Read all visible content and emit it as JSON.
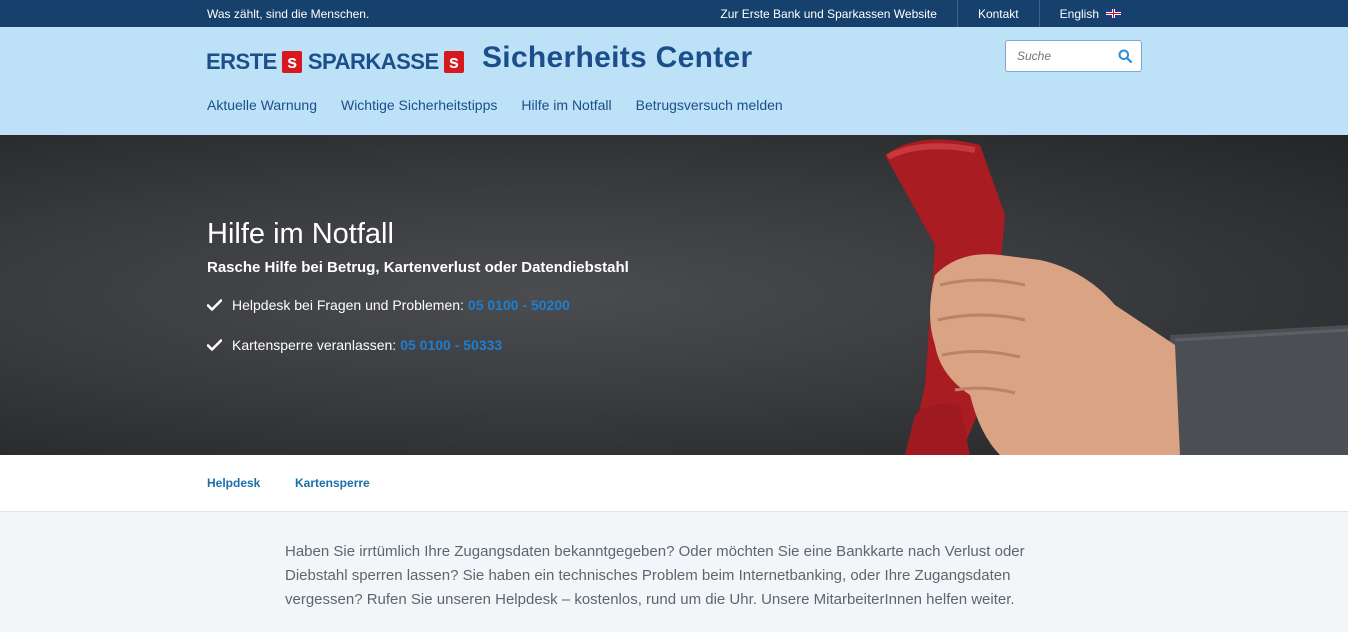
{
  "topbar": {
    "tagline": "Was zählt, sind die Menschen.",
    "links": [
      {
        "label": "Zur Erste Bank und Sparkassen Website"
      },
      {
        "label": "Kontakt"
      },
      {
        "label": "English"
      }
    ]
  },
  "header": {
    "logo_part1": "ERSTE",
    "logo_part2": "SPARKASSE",
    "logo_mark": "s",
    "title": "Sicherheits Center",
    "search_placeholder": "Suche",
    "nav": [
      {
        "label": "Aktuelle Warnung"
      },
      {
        "label": "Wichtige Sicherheitstipps"
      },
      {
        "label": "Hilfe im Notfall"
      },
      {
        "label": "Betrugsversuch melden"
      }
    ]
  },
  "hero": {
    "title": "Hilfe im Notfall",
    "subtitle": "Rasche Hilfe bei Betrug, Kartenverlust oder Datendiebstahl",
    "items": [
      {
        "text": "Helpdesk bei Fragen und Problemen:",
        "phone": "05 0100 - 50200"
      },
      {
        "text": "Kartensperre veranlassen:",
        "phone": "05 0100 - 50333"
      }
    ]
  },
  "subtabs": [
    {
      "label": "Helpdesk"
    },
    {
      "label": "Kartensperre"
    }
  ],
  "content": {
    "paragraph": "Haben Sie irrtümlich Ihre Zugangsdaten bekanntgegeben? Oder möchten Sie eine Bankkarte nach Verlust oder Diebstahl sperren lassen? Sie haben ein technisches Problem beim Internetbanking, oder Ihre Zugangsdaten vergessen? Rufen Sie unseren Helpdesk – kostenlos, rund um die Uhr. Unsere MitarbeiterInnen helfen weiter."
  },
  "colors": {
    "topbar": "#16416c",
    "header": "#bde2f7",
    "brand_blue": "#1b4e8a",
    "brand_red": "#d7191f",
    "phone_link": "#1e7ed1"
  },
  "icons": [
    "search-icon",
    "check-icon",
    "uk-flag-icon",
    "sparkasse-s-icon"
  ]
}
